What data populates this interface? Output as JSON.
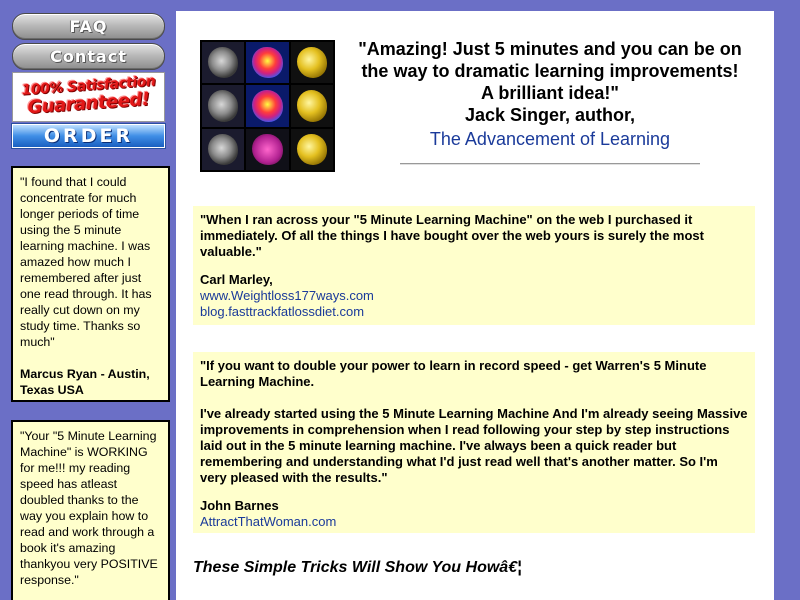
{
  "sidebar": {
    "faq_label": "FAQ",
    "contact_label": "Contact",
    "guarantee_line1": "100% Satisfaction",
    "guarantee_line2": "Guaranteed!",
    "order_label": "ORDER",
    "testimonials": [
      {
        "text": "\"I found that I could concentrate for much longer periods of time using the 5 minute learning machine. I was amazed how much I remembered after just one read through. It has really cut down on my study time. Thanks so much\"",
        "author": "Marcus Ryan - Austin, Texas USA"
      },
      {
        "text": "\"Your \"5 Minute Learning Machine\" is WORKING for me!!! my reading speed has atleast doubled thanks to the way you explain how to read and work through a book it's amazing thankyou very POSITIVE response.\"",
        "author": ""
      }
    ]
  },
  "main": {
    "headline": {
      "line1": "\"Amazing! Just 5 minutes and you can be on",
      "line2": "the way to dramatic learning improvements!",
      "line3": "A brilliant idea!\"",
      "line4": "Jack Singer, author,",
      "book": "The Advancement of Learning"
    },
    "quotes": [
      {
        "text": "\"When I ran across your \"5 Minute Learning Machine\" on the web I purchased it immediately. Of all the things I have bought over the web yours is surely the most valuable.\"",
        "name": "Carl Marley,",
        "links": [
          "www.Weightloss177ways.com",
          "blog.fasttrackfatlossdiet.com"
        ]
      },
      {
        "text": "\"If you want to double your power to learn in record speed - get Warren's 5 Minute Learning Machine.",
        "text2": "I've already started using the 5 Minute Learning Machine And I'm already seeing Massive improvements in comprehension when I read following your step by step instructions laid out in the 5 minute learning machine. I've always been a quick reader but remembering and understanding what I'd just read well that's another matter. So I'm very pleased with the results.\"",
        "name": "John Barnes",
        "links": [
          "AttractThatWoman.com"
        ]
      }
    ],
    "tagline": "These Simple Tricks Will Show You Howâ€¦"
  },
  "colors": {
    "background": "#6b6fc6",
    "panel": "#ffffff",
    "quote_bg": "#ffffcc",
    "link": "#1a3a9a",
    "guarantee_red": "#e21818"
  }
}
